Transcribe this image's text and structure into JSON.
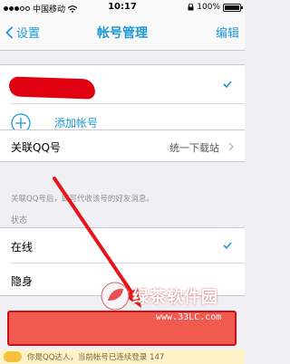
{
  "status_bar": {
    "carrier": "中国移动",
    "time": "10:17",
    "battery": "100%"
  },
  "nav": {
    "back_label": "设置",
    "title": "帐号管理",
    "edit_label": "编辑"
  },
  "accounts": {
    "add_label": "添加帐号"
  },
  "linked": {
    "label": "关联QQ号",
    "value": "统一下载站",
    "hint": "关联QQ号后，即可代收该号的好友消息。"
  },
  "status_section": {
    "header": "状态",
    "options": [
      {
        "label": "在线",
        "selected": true
      },
      {
        "label": "隐身",
        "selected": false
      }
    ]
  },
  "bottom_banner": {
    "text": "你是QQ达人，当前帐号已连续登录 147"
  },
  "watermark": {
    "title": "绿茶软件园",
    "url": "www.33LC.com"
  },
  "colors": {
    "accent": "#1e9ad6",
    "logout_red": "#f05a4f",
    "annotation_red": "#e8141c"
  }
}
